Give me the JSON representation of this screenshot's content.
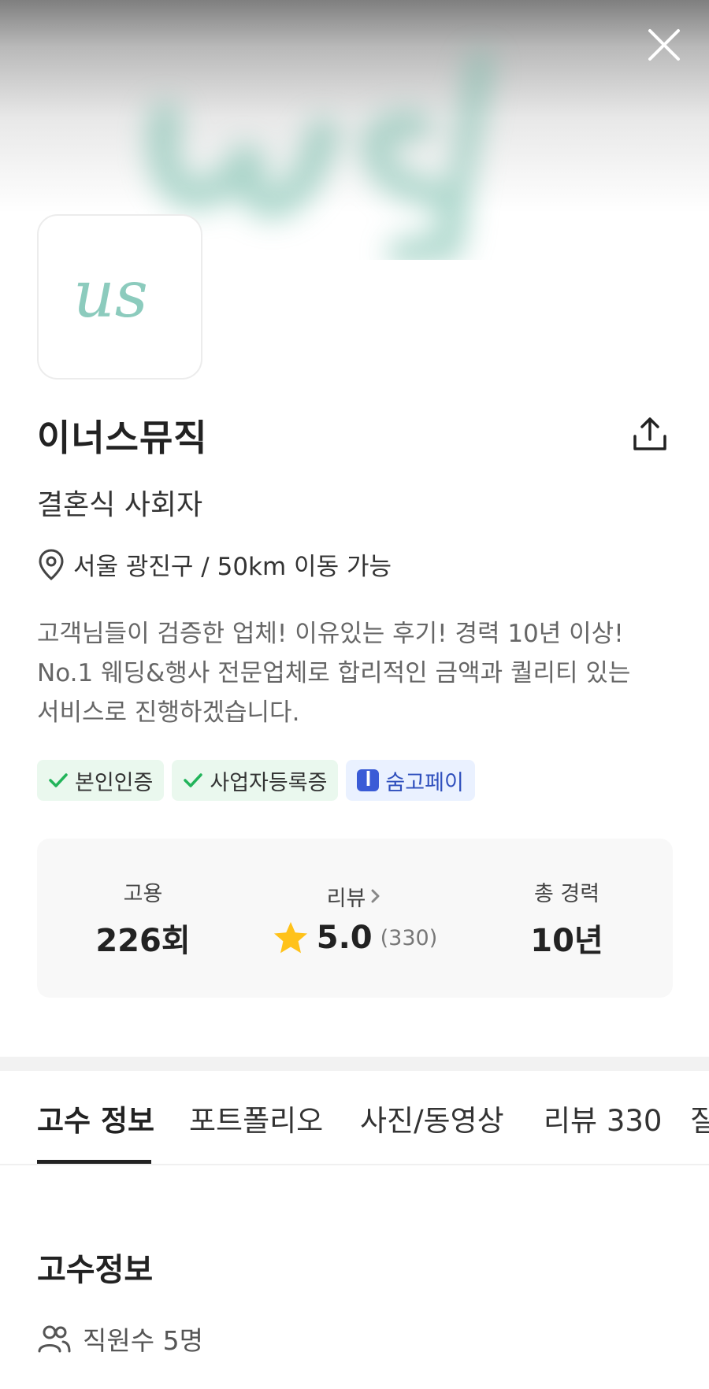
{
  "profile": {
    "logo_text": "us",
    "name": "이너스뮤직",
    "category": "결혼식 사회자",
    "location": "서울 광진구 / 50km 이동 가능",
    "intro_line1": "고객님들이 검증한 업체! 이유있는 후기! 경력 10년 이상!",
    "intro_line2": "No.1 웨딩&행사 전문업체로 합리적인 금액과 퀄리티 있는",
    "intro_line3": "서비스로 진행하겠습니다."
  },
  "badges": {
    "identity": "본인인증",
    "business": "사업자등록증",
    "pay": "숨고페이"
  },
  "stats": {
    "hire_label": "고용",
    "hire_value": "226회",
    "review_label": "리뷰",
    "review_rating": "5.0",
    "review_count": "(330)",
    "career_label": "총 경력",
    "career_value": "10년"
  },
  "tabs": [
    "고수 정보",
    "포트폴리오",
    "사진/동영상",
    "리뷰 330",
    "질"
  ],
  "section": {
    "title": "고수정보",
    "employees": "직원수 5명"
  },
  "colors": {
    "brand_logo": "#8ccbbd",
    "verify_check": "#22b45a",
    "star": "#ffc21a",
    "pay_blue": "#3a5bd6"
  },
  "icons": [
    "close-icon",
    "share-icon",
    "location-pin-icon",
    "check-icon",
    "soomgo-pay-icon",
    "chevron-right-icon",
    "star-icon",
    "people-icon"
  ]
}
